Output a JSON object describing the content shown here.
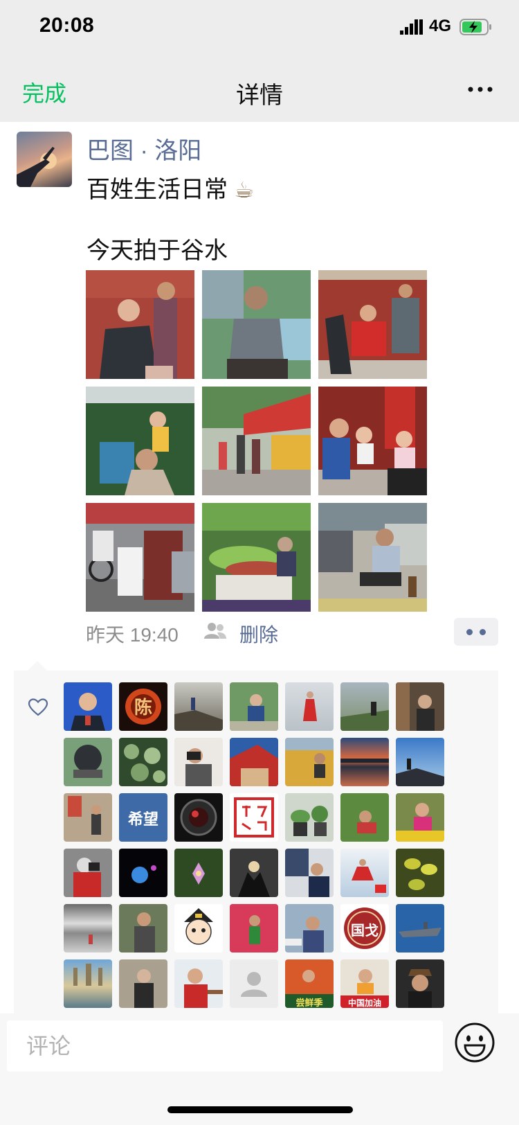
{
  "status_bar": {
    "time": "20:08",
    "network": "4G"
  },
  "nav": {
    "done_label": "完成",
    "title": "详情"
  },
  "post": {
    "author": "巴图 · 洛阳",
    "line1": "百姓生活日常",
    "cup_glyph": "☕",
    "line2": "今天拍于谷水",
    "photos": [
      "barber-haircut-red-wall",
      "man-yawning-seated",
      "haircut-by-red-gate",
      "girl-on-mans-shoulders",
      "street-market-umbrellas",
      "family-with-baby",
      "street-cyclists",
      "vegetable-cart-vendor",
      "elderly-man-smoking"
    ],
    "time": "昨天 19:40",
    "delete_label": "删除"
  },
  "likes": {
    "avatars": [
      {
        "name": "man-in-suit"
      },
      {
        "name": "fire-chen-logo",
        "text": "陈"
      },
      {
        "name": "cliff-hiker"
      },
      {
        "name": "man-seated-outdoors"
      },
      {
        "name": "woman-red-dress-sea"
      },
      {
        "name": "hiker-on-hill"
      },
      {
        "name": "photographer-wall"
      },
      {
        "name": "motorcycle-helmet"
      },
      {
        "name": "lotus-leaves"
      },
      {
        "name": "photographer-camera"
      },
      {
        "name": "tiananmen"
      },
      {
        "name": "wheat-field-woman"
      },
      {
        "name": "sunset-reflection"
      },
      {
        "name": "mountain-silhouette"
      },
      {
        "name": "street-shop"
      },
      {
        "name": "hope-text-poster",
        "text": "希望"
      },
      {
        "name": "camera-lens"
      },
      {
        "name": "red-seal-calligraphy"
      },
      {
        "name": "potted-plants"
      },
      {
        "name": "woman-in-grass"
      },
      {
        "name": "woman-yellow-flowers"
      },
      {
        "name": "woman-red-coat-camera"
      },
      {
        "name": "blue-moon-night"
      },
      {
        "name": "pink-orchid"
      },
      {
        "name": "hands-sunset"
      },
      {
        "name": "man-with-poster"
      },
      {
        "name": "woman-red-skirt-beach"
      },
      {
        "name": "yellow-leaves"
      },
      {
        "name": "misty-lake"
      },
      {
        "name": "man-with-camera-tree"
      },
      {
        "name": "cartoon-boy"
      },
      {
        "name": "woman-azaleas"
      },
      {
        "name": "man-camera-harbor"
      },
      {
        "name": "guoge-badge",
        "text": "国戈"
      },
      {
        "name": "aircraft-carrier"
      },
      {
        "name": "pagodas-reflection"
      },
      {
        "name": "old-man-temple"
      },
      {
        "name": "man-red-shirt"
      },
      {
        "name": "default-avatar"
      },
      {
        "name": "food-banner",
        "text": "尝鲜季"
      },
      {
        "name": "china-jiayou",
        "text": "中国加油"
      },
      {
        "name": "man-in-cap"
      }
    ]
  },
  "comment": {
    "placeholder": "评论"
  },
  "colors": {
    "accent_green": "#07c160",
    "link_blue": "#576b95",
    "bar_gray": "#ededed"
  }
}
